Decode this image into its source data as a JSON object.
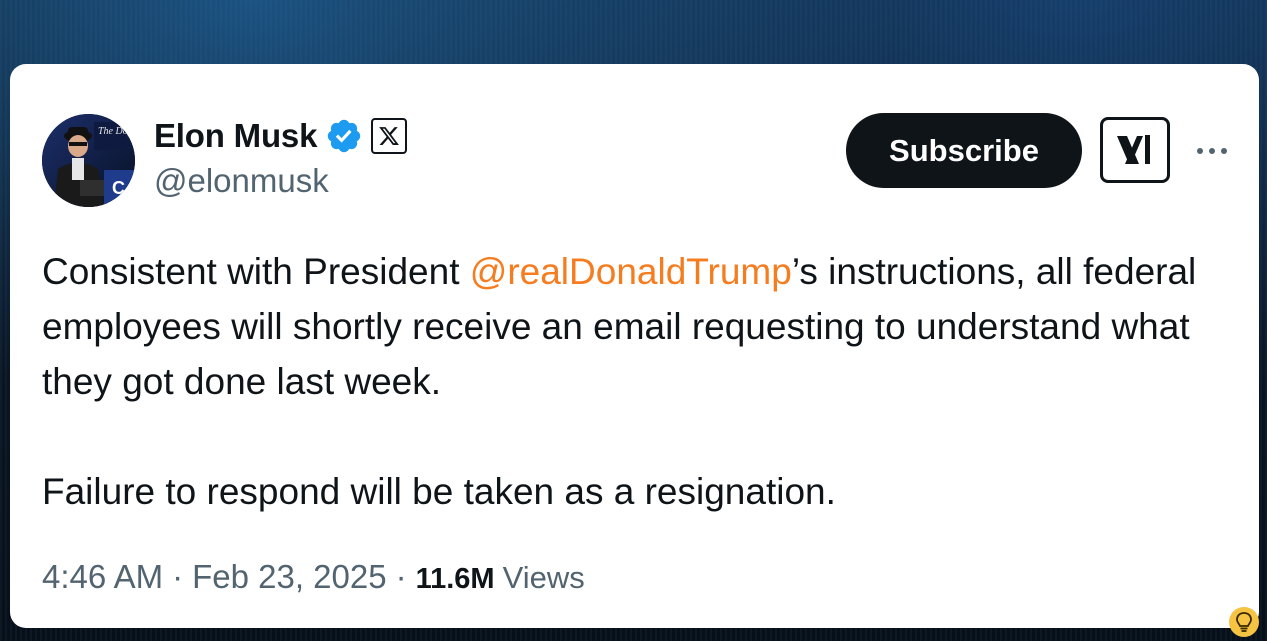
{
  "author": {
    "display_name": "Elon Musk",
    "handle": "@elonmusk",
    "avatar_text": "The Dogefa",
    "verified": true,
    "affiliation_badge": "x-logo-icon"
  },
  "header": {
    "subscribe_label": "Subscribe",
    "grok_icon": "xai-logo-icon",
    "more_icon": "more-horizontal-icon"
  },
  "tweet": {
    "text_before": "Consistent with President ",
    "mention": "@realDonaldTrump",
    "text_after": "’s instructions, all federal employees will shortly receive an email requesting to understand what they got done last week.",
    "second_paragraph": "Failure to respond will be taken as a resignation."
  },
  "meta": {
    "time": "4:46 AM",
    "separator": "·",
    "date": "Feb 23, 2025",
    "views_count": "11.6M",
    "views_label": "Views"
  },
  "colors": {
    "mention": "#f57c1f",
    "verified": "#1d9bf0",
    "text": "#0f1419",
    "secondary": "#536471",
    "button_bg": "#0f1419"
  },
  "corner_icon": "lightbulb-icon"
}
